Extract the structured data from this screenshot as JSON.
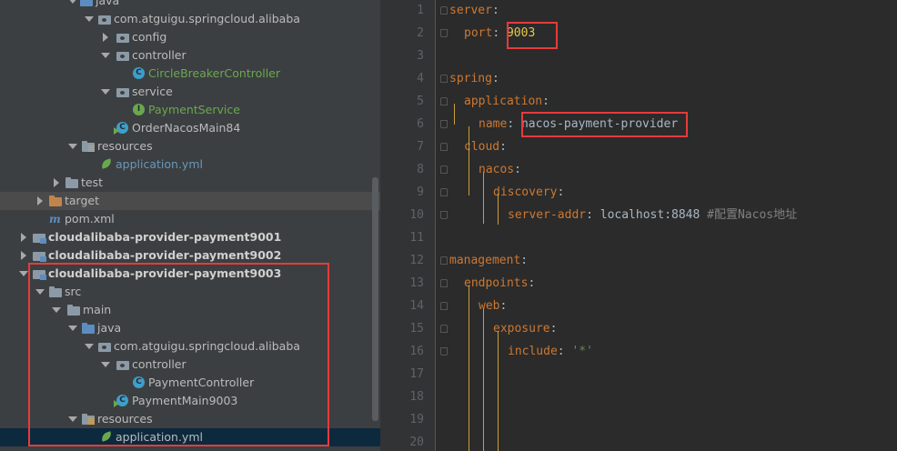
{
  "project_tree": {
    "rows": [
      {
        "label": "java",
        "icon": "java-folder-icon",
        "arrow": "down",
        "style": "normal"
      },
      {
        "label": "com.atguigu.springcloud.alibaba",
        "icon": "package-icon",
        "arrow": "down",
        "style": "normal"
      },
      {
        "label": "config",
        "icon": "package-icon",
        "arrow": "right",
        "style": "normal"
      },
      {
        "label": "controller",
        "icon": "package-icon",
        "arrow": "down",
        "style": "normal"
      },
      {
        "label": "CircleBreakerController",
        "icon": "class-icon",
        "arrow": "none",
        "style": "green"
      },
      {
        "label": "service",
        "icon": "package-icon",
        "arrow": "down",
        "style": "normal"
      },
      {
        "label": "PaymentService",
        "icon": "interface-icon",
        "arrow": "none",
        "style": "green"
      },
      {
        "label": "OrderNacosMain84",
        "icon": "main-class-icon",
        "arrow": "none",
        "style": "normal"
      },
      {
        "label": "resources",
        "icon": "resources-folder-icon",
        "arrow": "down",
        "style": "normal"
      },
      {
        "label": "application.yml",
        "icon": "spring-yml-icon",
        "arrow": "none",
        "style": "blue"
      },
      {
        "label": "test",
        "icon": "folder-icon",
        "arrow": "right",
        "style": "normal"
      },
      {
        "label": "target",
        "icon": "target-folder-icon",
        "arrow": "right",
        "style": "normal"
      },
      {
        "label": "pom.xml",
        "icon": "maven-icon",
        "arrow": "none",
        "style": "normal"
      },
      {
        "label": "cloudalibaba-provider-payment9001",
        "icon": "module-icon",
        "arrow": "right",
        "style": "bold"
      },
      {
        "label": "cloudalibaba-provider-payment9002",
        "icon": "module-icon",
        "arrow": "right",
        "style": "bold"
      },
      {
        "label": "cloudalibaba-provider-payment9003",
        "icon": "module-icon",
        "arrow": "down",
        "style": "bold"
      },
      {
        "label": "src",
        "icon": "folder-icon",
        "arrow": "down",
        "style": "normal"
      },
      {
        "label": "main",
        "icon": "folder-icon",
        "arrow": "down",
        "style": "normal"
      },
      {
        "label": "java",
        "icon": "java-folder-icon",
        "arrow": "down",
        "style": "normal"
      },
      {
        "label": "com.atguigu.springcloud.alibaba",
        "icon": "package-icon",
        "arrow": "down",
        "style": "normal"
      },
      {
        "label": "controller",
        "icon": "package-icon",
        "arrow": "down",
        "style": "normal"
      },
      {
        "label": "PaymentController",
        "icon": "class-icon",
        "arrow": "none",
        "style": "normal"
      },
      {
        "label": "PaymentMain9003",
        "icon": "main-class-icon",
        "arrow": "none",
        "style": "normal"
      },
      {
        "label": "resources",
        "icon": "resources-folder-icon",
        "arrow": "down",
        "style": "normal"
      },
      {
        "label": "application.yml",
        "icon": "spring-yml-icon",
        "arrow": "none",
        "style": "normal"
      }
    ]
  },
  "editor": {
    "lines": [
      {
        "n": "1",
        "key": "server",
        "val": ""
      },
      {
        "n": "2",
        "key": "port",
        "val": "9003"
      },
      {
        "n": "3",
        "key": "",
        "val": ""
      },
      {
        "n": "4",
        "key": "spring",
        "val": ""
      },
      {
        "n": "5",
        "key": "application",
        "val": ""
      },
      {
        "n": "6",
        "key": "name",
        "val": "nacos-payment-provider"
      },
      {
        "n": "7",
        "key": "cloud",
        "val": ""
      },
      {
        "n": "8",
        "key": "nacos",
        "val": ""
      },
      {
        "n": "9",
        "key": "discovery",
        "val": ""
      },
      {
        "n": "10",
        "key": "server-addr",
        "val": "localhost:8848",
        "comment": "#配置Nacos地址"
      },
      {
        "n": "11",
        "key": "",
        "val": ""
      },
      {
        "n": "12",
        "key": "management",
        "val": ""
      },
      {
        "n": "13",
        "key": "endpoints",
        "val": ""
      },
      {
        "n": "14",
        "key": "web",
        "val": ""
      },
      {
        "n": "15",
        "key": "exposure",
        "val": ""
      },
      {
        "n": "16",
        "key": "include",
        "val": "'*'"
      },
      {
        "n": "17",
        "key": "",
        "val": ""
      },
      {
        "n": "18",
        "key": "",
        "val": ""
      },
      {
        "n": "19",
        "key": "",
        "val": ""
      },
      {
        "n": "20",
        "key": "",
        "val": ""
      }
    ]
  },
  "colors": {
    "key": "#cc7832",
    "value_highlight": "#e6c84a",
    "string": "#6a8759",
    "comment": "#808080",
    "annotation_box": "#e63b3b"
  }
}
